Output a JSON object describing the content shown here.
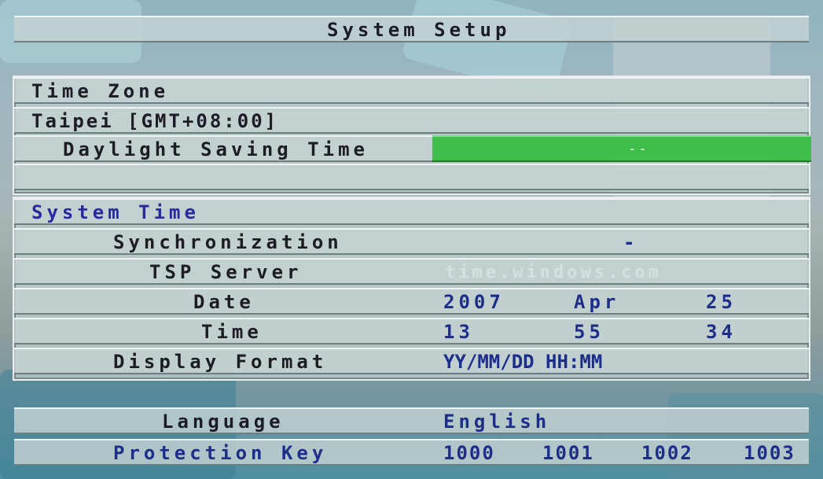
{
  "title": "System Setup",
  "time_zone": {
    "heading": "Time Zone",
    "value": "Taipei [GMT+08:00]",
    "dst_label": "Daylight Saving Time",
    "dst_value": "--"
  },
  "system_time": {
    "heading": "System Time",
    "sync_label": "Synchronization",
    "sync_value": "-",
    "tsp_label": "TSP Server",
    "tsp_value": "time.windows.com",
    "date_label": "Date",
    "date_year": "2007",
    "date_month": "Apr",
    "date_day": "25",
    "time_label": "Time",
    "time_hour": "13",
    "time_min": "55",
    "time_sec": "34",
    "format_label": "Display Format",
    "format_value": "YY/MM/DD HH:MM"
  },
  "language": {
    "label": "Language",
    "value": "English"
  },
  "protection_key": {
    "label": "Protection Key",
    "values": [
      "1000",
      "1001",
      "1002",
      "1003"
    ]
  },
  "colors": {
    "highlight": "#3fbf49",
    "label_text": "#1c1c24",
    "value_text": "#1d2e8a",
    "heading_blue": "#2a2aa0"
  }
}
